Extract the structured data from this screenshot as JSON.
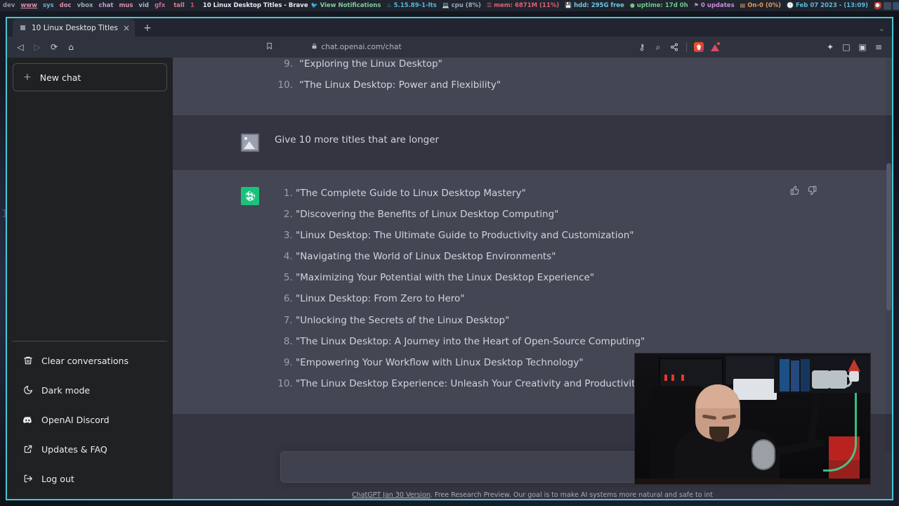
{
  "statusbar": {
    "tags": [
      {
        "label": "dev",
        "state": "normal"
      },
      {
        "label": "www",
        "state": "selected"
      },
      {
        "label": "sys",
        "state": "normal"
      },
      {
        "label": "doc",
        "state": "normal"
      },
      {
        "label": "vbox",
        "state": "normal"
      },
      {
        "label": "chat",
        "state": "normal"
      },
      {
        "label": "mus",
        "state": "normal"
      },
      {
        "label": "vid",
        "state": "normal"
      },
      {
        "label": "gfx",
        "state": "normal"
      },
      {
        "label": "tall",
        "state": "layout"
      },
      {
        "label": "1",
        "state": "count"
      }
    ],
    "window_title": "10 Linux Desktop Titles - Brave",
    "modules": [
      {
        "name": "notifications",
        "icon": "twitter-bird-icon",
        "label": "View Notifications",
        "color": "#7ec9a0"
      },
      {
        "name": "kernel",
        "icon": "thermometer-icon",
        "label": "5.15.89-1-lts",
        "color": "#58b8d8"
      },
      {
        "name": "cpu",
        "icon": "monitor-icon",
        "label": "cpu (8%)",
        "color": "#9aa7bb"
      },
      {
        "name": "memory",
        "icon": "ram-icon",
        "label": "mem: 6871M (11%)",
        "color": "#e0607a"
      },
      {
        "name": "disk",
        "icon": "hdd-icon",
        "label": "hdd: 295G free",
        "color": "#6fc6e2"
      },
      {
        "name": "uptime",
        "icon": "clock-icon",
        "label": "uptime: 17d 0h",
        "color": "#6ec98a"
      },
      {
        "name": "updates",
        "icon": "bell-icon",
        "label": "0 updates",
        "color": "#c98ad8"
      },
      {
        "name": "audio-device",
        "icon": "speaker-icon",
        "label": "On-0 (0%)",
        "color": "#e09a5a"
      },
      {
        "name": "datetime",
        "icon": "calendar-icon",
        "label": "Feb 07 2023 - (13:09)",
        "color": "#5ab8d8"
      }
    ]
  },
  "browser": {
    "tab": {
      "title": "10 Linux Desktop Titles",
      "close_label": "×",
      "favicon": "page-favicon"
    },
    "new_tab_label": "+",
    "window_chevron": "⌄",
    "toolbar": {
      "back": "◁",
      "forward": "▷",
      "reload": "⟳",
      "home": "⌂",
      "bookmark": "☐",
      "lock": "■",
      "url": "chat.openai.com/chat",
      "password_icon": "⚷",
      "zoom_icon": "⌕",
      "share_icon": "≤",
      "brave_shields": "brave-lion-icon",
      "brave_rewards": "brave-triangle-icon",
      "extensions": "✦",
      "sidebar": "□",
      "profile": "▣",
      "menu": "≡"
    }
  },
  "sidebar": {
    "new_chat": {
      "label": "New chat",
      "icon": "plus-icon"
    },
    "bottom_items": [
      {
        "label": "Clear conversations",
        "icon": "trash-icon"
      },
      {
        "label": "Dark mode",
        "icon": "moon-icon"
      },
      {
        "label": "OpenAI Discord",
        "icon": "discord-icon"
      },
      {
        "label": "Updates & FAQ",
        "icon": "external-link-icon"
      },
      {
        "label": "Log out",
        "icon": "logout-icon"
      }
    ]
  },
  "conversation": {
    "previous_answer_tail": [
      "“Exploring the Linux Desktop\"",
      "“The Linux Desktop: Power and Flexibility\""
    ],
    "user_message": {
      "avatar": "user-avatar",
      "text": "Give 10 more titles that are longer"
    },
    "assistant_message": {
      "avatar": "chatgpt-logo-icon",
      "titles": [
        "\"The Complete Guide to Linux Desktop Mastery\"",
        "\"Discovering the Benefits of Linux Desktop Computing\"",
        "\"Linux Desktop: The Ultimate Guide to Productivity and Customization\"",
        "\"Navigating the World of Linux Desktop Environments\"",
        "\"Maximizing Your Potential with the Linux Desktop Experience\"",
        "\"Linux Desktop: From Zero to Hero\"",
        "\"Unlocking the Secrets of the Linux Desktop\"",
        "\"The Linux Desktop: A Journey into the Heart of Open-Source Computing\"",
        "\"Empowering Your Workflow with Linux Desktop Technology\"",
        "\"The Linux Desktop Experience: Unleash Your Creativity and Productivity\""
      ],
      "actions": [
        {
          "name": "thumbs-up",
          "label": "Good response"
        },
        {
          "name": "thumbs-down",
          "label": "Bad response"
        }
      ]
    }
  },
  "composer": {
    "placeholder": "",
    "value": ""
  },
  "footer": {
    "link_text": "ChatGPT Jan 30 Version",
    "text": ". Free Research Preview. Our goal is to make AI systems more natural and safe to int"
  },
  "webcam": {
    "label": "webcam-overlay"
  },
  "colors": {
    "accent_green": "#19c37d",
    "window_border": "#49c6d4",
    "bot_bg": "#444654",
    "user_bg": "#343541",
    "sidebar_bg": "#202123"
  }
}
